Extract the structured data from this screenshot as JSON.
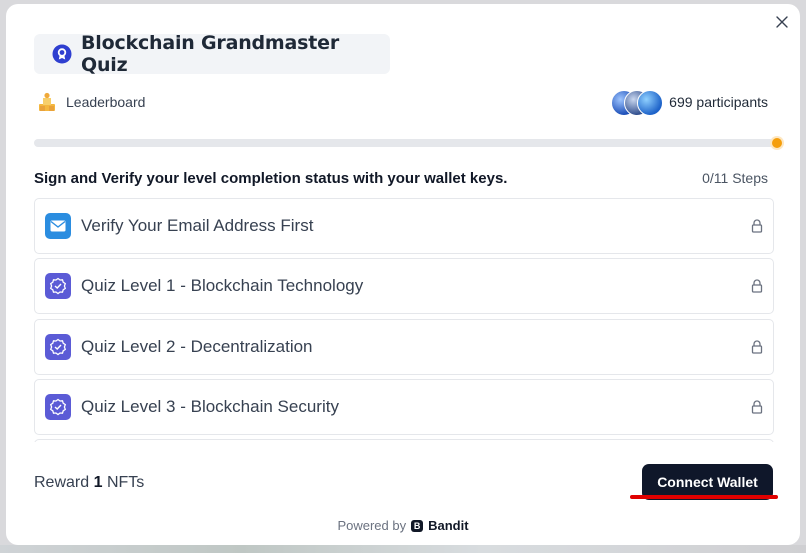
{
  "modal": {
    "title": "Blockchain Grandmaster Quiz",
    "title_icon": "quiz-badge-icon",
    "close_icon": "close-icon"
  },
  "leaderboard": {
    "label": "Leaderboard",
    "icon": "trophy-icon"
  },
  "participants": {
    "label": "699 participants"
  },
  "progress": {
    "completed": 0,
    "total": 11,
    "fraction": 0.0,
    "accent": "#f59e0b"
  },
  "instructions": "Sign and Verify your level completion status with your wallet keys.",
  "steps_label": "0/11 Steps",
  "steps": [
    {
      "label": "Verify Your Email Address First",
      "icon": "email-icon",
      "color": "#2b8de0"
    },
    {
      "label": "Quiz Level 1 - Blockchain Technology",
      "icon": "verified-badge-icon",
      "color": "#5b5bd6"
    },
    {
      "label": "Quiz Level 2 - Decentralization",
      "icon": "verified-badge-icon",
      "color": "#5b5bd6"
    },
    {
      "label": "Quiz Level 3 - Blockchain Security",
      "icon": "verified-badge-icon",
      "color": "#5b5bd6"
    }
  ],
  "reward": {
    "prefix": "Reward",
    "count": "1",
    "unit": "NFTs"
  },
  "connect_button": {
    "label": "Connect Wallet"
  },
  "footer": {
    "powered_by": "Powered by",
    "brand": "Bandit",
    "brand_logo_letter": "B"
  }
}
